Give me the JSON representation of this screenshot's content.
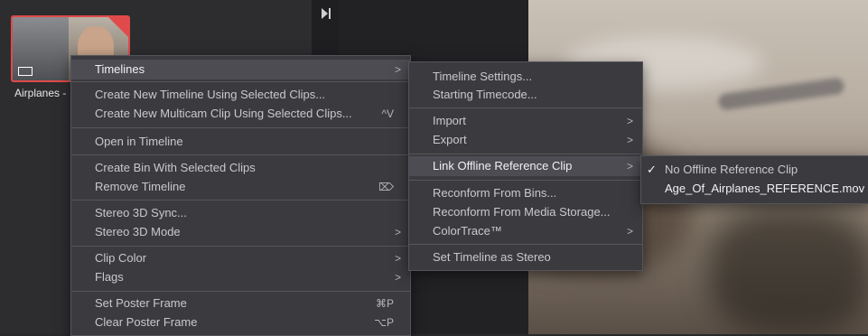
{
  "clip": {
    "label": "Airplanes -"
  },
  "main_menu": {
    "timelines": "Timelines",
    "create_timeline": "Create New Timeline Using Selected Clips...",
    "create_multicam": "Create New Multicam Clip Using Selected Clips...",
    "create_multicam_shortcut": "^V",
    "open_in_timeline": "Open in Timeline",
    "create_bin": "Create Bin With Selected Clips",
    "remove_timeline": "Remove Timeline",
    "remove_timeline_shortcut": "⌦",
    "stereo_sync": "Stereo 3D Sync...",
    "stereo_mode": "Stereo 3D Mode",
    "clip_color": "Clip Color",
    "flags": "Flags",
    "set_poster": "Set Poster Frame",
    "set_poster_shortcut": "⌘P",
    "clear_poster": "Clear Poster Frame",
    "clear_poster_shortcut": "⌥P"
  },
  "timelines_submenu": {
    "timeline_settings": "Timeline Settings...",
    "starting_timecode": "Starting Timecode...",
    "import": "Import",
    "export": "Export",
    "link_offline": "Link Offline Reference Clip",
    "reconform_bins": "Reconform From Bins...",
    "reconform_media": "Reconform From Media Storage...",
    "colortrace": "ColorTrace™",
    "set_stereo": "Set Timeline as Stereo"
  },
  "offline_submenu": {
    "checkmark": "✓",
    "no_reference": "No Offline Reference Clip",
    "reference_file": "Age_Of_Airplanes_REFERENCE.mov"
  },
  "arrow_glyph": ">",
  "colors": {
    "selection_border": "#e04a4a",
    "menu_bg": "#3b3b3f",
    "highlight": "#4c4c52"
  }
}
